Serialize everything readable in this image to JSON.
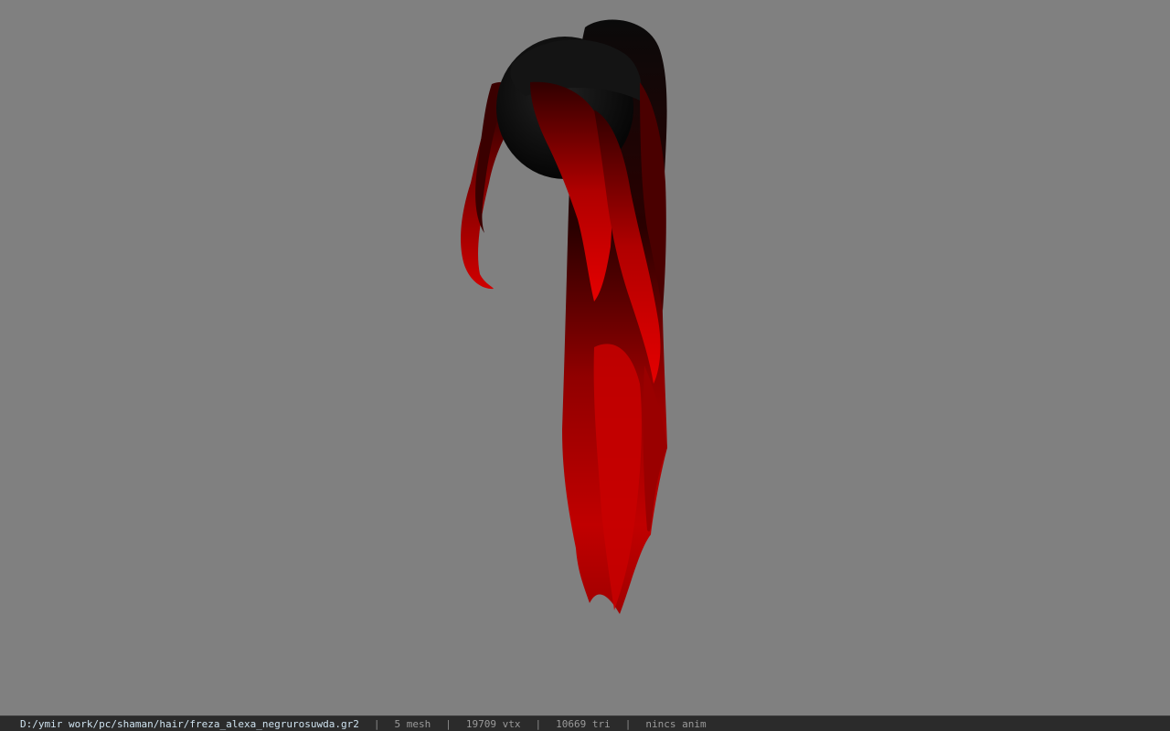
{
  "viewport": {
    "background_color": "#808080",
    "model_colors": {
      "dark": "#0d0d0d",
      "red": "#b00000",
      "bright_red": "#e00000"
    }
  },
  "status_bar": {
    "file_path": "D:/ymir work/pc/shaman/hair/freza_alexa_negrurosuwda.gr2",
    "separator": "|",
    "mesh": "5 mesh",
    "vertices": "19709 vtx",
    "triangles": "10669 tri",
    "anim": "nincs anim"
  }
}
